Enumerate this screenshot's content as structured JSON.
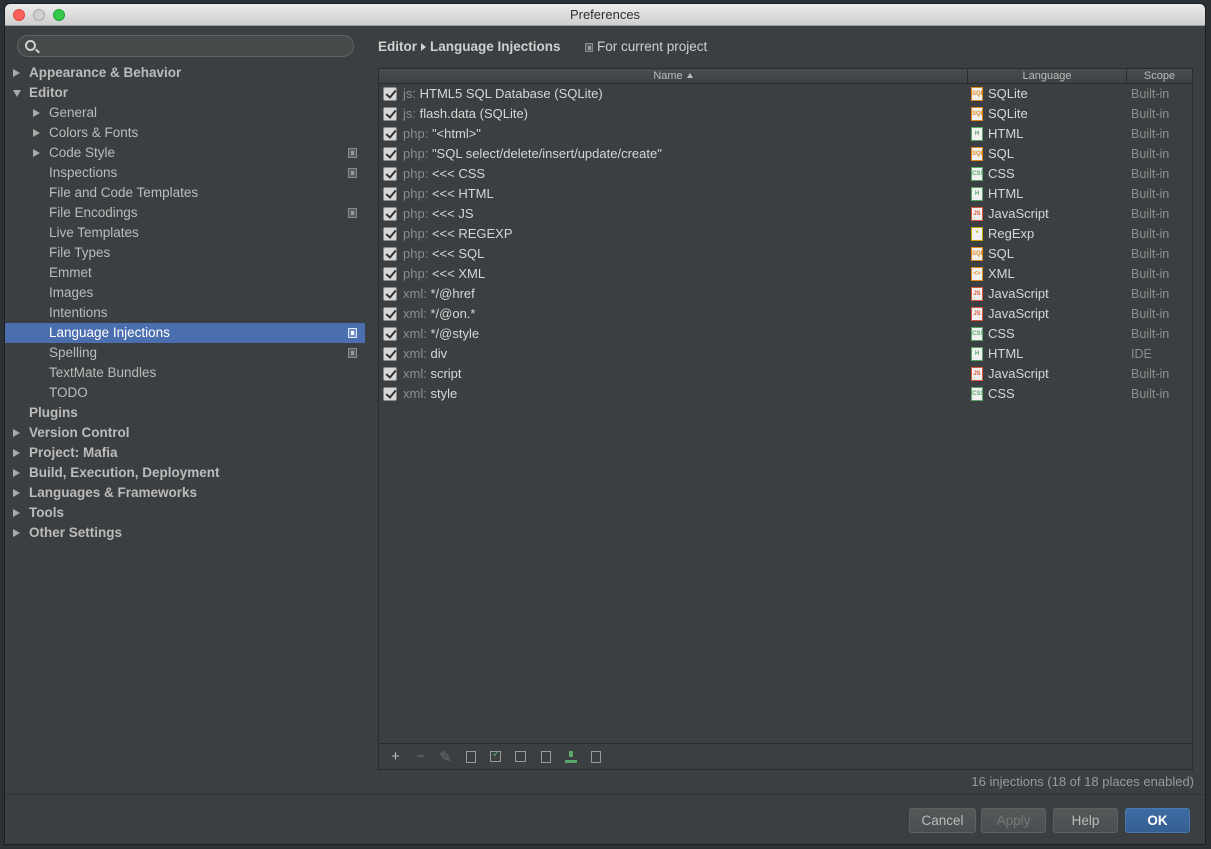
{
  "window": {
    "title": "Preferences"
  },
  "search": {
    "placeholder": ""
  },
  "tree": [
    {
      "label": "Appearance & Behavior",
      "level": 0,
      "arrow": "right",
      "bold": true
    },
    {
      "label": "Editor",
      "level": 0,
      "arrow": "down",
      "bold": true
    },
    {
      "label": "General",
      "level": 1,
      "arrow": "right"
    },
    {
      "label": "Colors & Fonts",
      "level": 1,
      "arrow": "right"
    },
    {
      "label": "Code Style",
      "level": 1,
      "arrow": "right",
      "projectIcon": true
    },
    {
      "label": "Inspections",
      "level": 1,
      "projectIcon": true
    },
    {
      "label": "File and Code Templates",
      "level": 1
    },
    {
      "label": "File Encodings",
      "level": 1,
      "projectIcon": true
    },
    {
      "label": "Live Templates",
      "level": 1
    },
    {
      "label": "File Types",
      "level": 1
    },
    {
      "label": "Emmet",
      "level": 1
    },
    {
      "label": "Images",
      "level": 1
    },
    {
      "label": "Intentions",
      "level": 1
    },
    {
      "label": "Language Injections",
      "level": 1,
      "selected": true,
      "projectIcon": true
    },
    {
      "label": "Spelling",
      "level": 1,
      "projectIcon": true
    },
    {
      "label": "TextMate Bundles",
      "level": 1
    },
    {
      "label": "TODO",
      "level": 1
    },
    {
      "label": "Plugins",
      "level": 0,
      "bold": true
    },
    {
      "label": "Version Control",
      "level": 0,
      "arrow": "right",
      "bold": true
    },
    {
      "label": "Project: Mafia",
      "level": 0,
      "arrow": "right",
      "bold": true
    },
    {
      "label": "Build, Execution, Deployment",
      "level": 0,
      "arrow": "right",
      "bold": true
    },
    {
      "label": "Languages & Frameworks",
      "level": 0,
      "arrow": "right",
      "bold": true
    },
    {
      "label": "Tools",
      "level": 0,
      "arrow": "right",
      "bold": true
    },
    {
      "label": "Other Settings",
      "level": 0,
      "arrow": "right",
      "bold": true
    }
  ],
  "content": {
    "breadcrumb_parent": "Editor",
    "breadcrumb_current": "Language Injections",
    "scope_note": "For current project"
  },
  "table": {
    "headers": {
      "name": "Name",
      "language": "Language",
      "scope": "Scope"
    },
    "rows": [
      {
        "prefix": "js:",
        "name": "HTML5 SQL Database (SQLite)",
        "language": "SQLite",
        "lang_icon": "SQL",
        "icon_color": "#e08a1e",
        "scope": "Built-in"
      },
      {
        "prefix": "js:",
        "name": "flash.data (SQLite)",
        "language": "SQLite",
        "lang_icon": "SQL",
        "icon_color": "#e08a1e",
        "scope": "Built-in"
      },
      {
        "prefix": "php:",
        "name": "\"<html>\"",
        "language": "HTML",
        "lang_icon": "H",
        "icon_color": "#59a869",
        "scope": "Built-in"
      },
      {
        "prefix": "php:",
        "name": "\"SQL select/delete/insert/update/create\"",
        "language": "SQL",
        "lang_icon": "SQL",
        "icon_color": "#e08a1e",
        "scope": "Built-in"
      },
      {
        "prefix": "php:",
        "name": "<<< CSS",
        "language": "CSS",
        "lang_icon": "CSS",
        "icon_color": "#59a869",
        "scope": "Built-in"
      },
      {
        "prefix": "php:",
        "name": "<<< HTML",
        "language": "HTML",
        "lang_icon": "H",
        "icon_color": "#59a869",
        "scope": "Built-in"
      },
      {
        "prefix": "php:",
        "name": "<<< JS",
        "language": "JavaScript",
        "lang_icon": "JS",
        "icon_color": "#d9583b",
        "scope": "Built-in"
      },
      {
        "prefix": "php:",
        "name": "<<< REGEXP",
        "language": "RegExp",
        "lang_icon": "*",
        "icon_color": "#c8a800",
        "scope": "Built-in"
      },
      {
        "prefix": "php:",
        "name": "<<< SQL",
        "language": "SQL",
        "lang_icon": "SQL",
        "icon_color": "#e08a1e",
        "scope": "Built-in"
      },
      {
        "prefix": "php:",
        "name": "<<< XML",
        "language": "XML",
        "lang_icon": "<>",
        "icon_color": "#e08a1e",
        "scope": "Built-in"
      },
      {
        "prefix": "xml:",
        "name": "*/@href",
        "language": "JavaScript",
        "lang_icon": "JS",
        "icon_color": "#d9583b",
        "scope": "Built-in"
      },
      {
        "prefix": "xml:",
        "name": "*/@on.*",
        "language": "JavaScript",
        "lang_icon": "JS",
        "icon_color": "#d9583b",
        "scope": "Built-in"
      },
      {
        "prefix": "xml:",
        "name": "*/@style",
        "language": "CSS",
        "lang_icon": "CSS",
        "icon_color": "#59a869",
        "scope": "Built-in"
      },
      {
        "prefix": "xml:",
        "name": "div",
        "language": "HTML",
        "lang_icon": "H",
        "icon_color": "#59a869",
        "scope": "IDE"
      },
      {
        "prefix": "xml:",
        "name": "script",
        "language": "JavaScript",
        "lang_icon": "JS",
        "icon_color": "#d9583b",
        "scope": "Built-in"
      },
      {
        "prefix": "xml:",
        "name": "style",
        "language": "CSS",
        "lang_icon": "CSS",
        "icon_color": "#59a869",
        "scope": "Built-in"
      }
    ],
    "toolbar": {
      "add": "+",
      "remove": "−",
      "edit": "✎"
    },
    "status": "16 injections (18 of 18 places enabled)"
  },
  "buttons": {
    "cancel": "Cancel",
    "apply": "Apply",
    "help": "Help",
    "ok": "OK"
  }
}
